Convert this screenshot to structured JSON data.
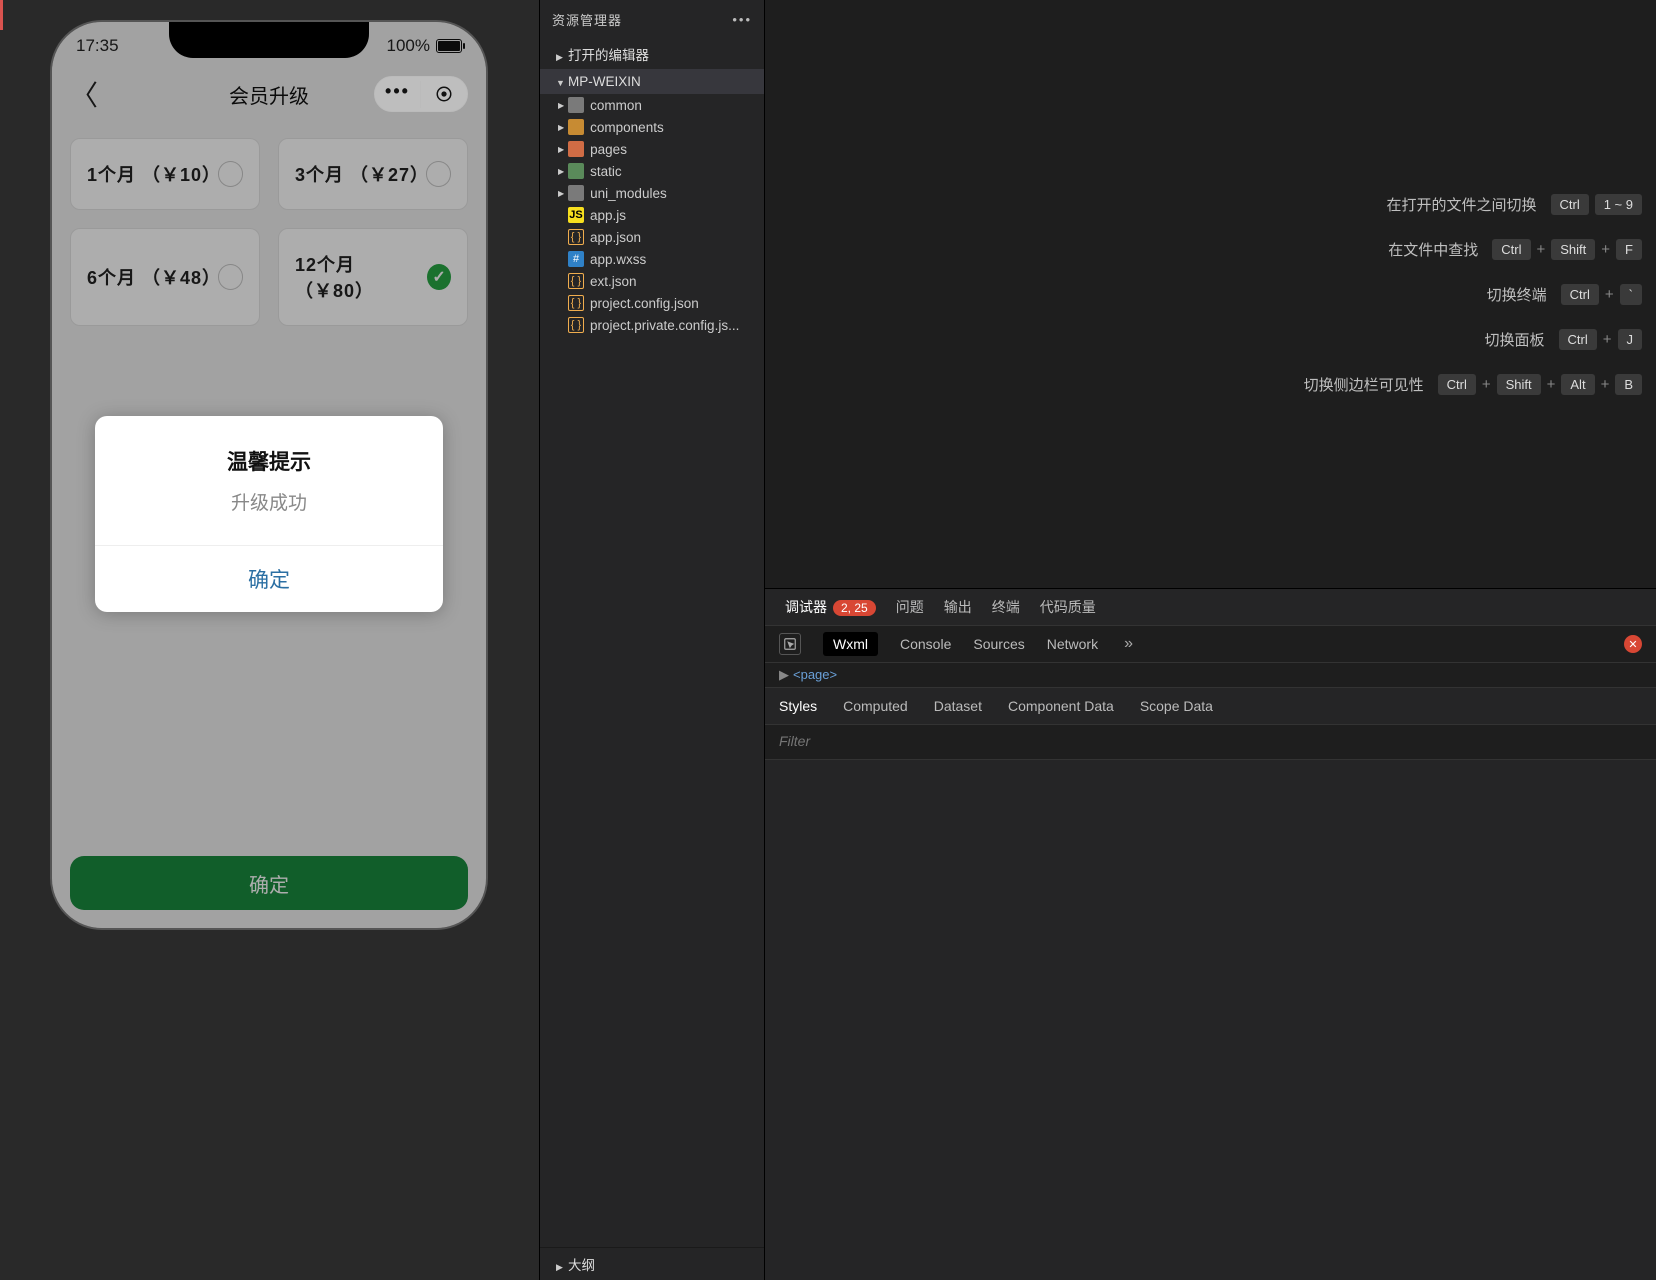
{
  "simulator": {
    "time": "17:35",
    "battery_text": "100%",
    "nav_title": "会员升级",
    "plans": [
      {
        "label": "1个月 （￥10）",
        "selected": false
      },
      {
        "label": "3个月 （￥27）",
        "selected": false
      },
      {
        "label": "6个月 （￥48）",
        "selected": false
      },
      {
        "label": "12个月 （￥80）",
        "selected": true
      }
    ],
    "confirm_label": "确定",
    "modal": {
      "title": "温馨提示",
      "message": "升级成功",
      "ok": "确定"
    }
  },
  "explorer": {
    "panel_title": "资源管理器",
    "editors_section": "打开的编辑器",
    "project_name": "MP-WEIXIN",
    "folders": [
      "common",
      "components",
      "pages",
      "static",
      "uni_modules"
    ],
    "files": [
      "app.js",
      "app.json",
      "app.wxss",
      "ext.json",
      "project.config.json",
      "project.private.config.js..."
    ],
    "outline": "大纲"
  },
  "editor_hints": [
    {
      "label": "在打开的文件之间切换",
      "keys": [
        "Ctrl",
        "1 ~ 9"
      ]
    },
    {
      "label": "在文件中查找",
      "keys": [
        "Ctrl",
        "+",
        "Shift",
        "+",
        "F"
      ]
    },
    {
      "label": "切换终端",
      "keys": [
        "Ctrl",
        "+",
        "`"
      ]
    },
    {
      "label": "切换面板",
      "keys": [
        "Ctrl",
        "+",
        "J"
      ]
    },
    {
      "label": "切换侧边栏可见性",
      "keys": [
        "Ctrl",
        "+",
        "Shift",
        "+",
        "Alt",
        "+",
        "B"
      ]
    }
  ],
  "devtools": {
    "bottom_tabs": {
      "debugger": "调试器",
      "badge": "2, 25",
      "problems": "问题",
      "output": "输出",
      "terminal": "终端",
      "quality": "代码质量"
    },
    "inspect_tabs": [
      "Wxml",
      "Console",
      "Sources",
      "Network"
    ],
    "wxml_root": "<page>",
    "styles_tabs": [
      "Styles",
      "Computed",
      "Dataset",
      "Component Data",
      "Scope Data"
    ],
    "filter_placeholder": "Filter"
  }
}
